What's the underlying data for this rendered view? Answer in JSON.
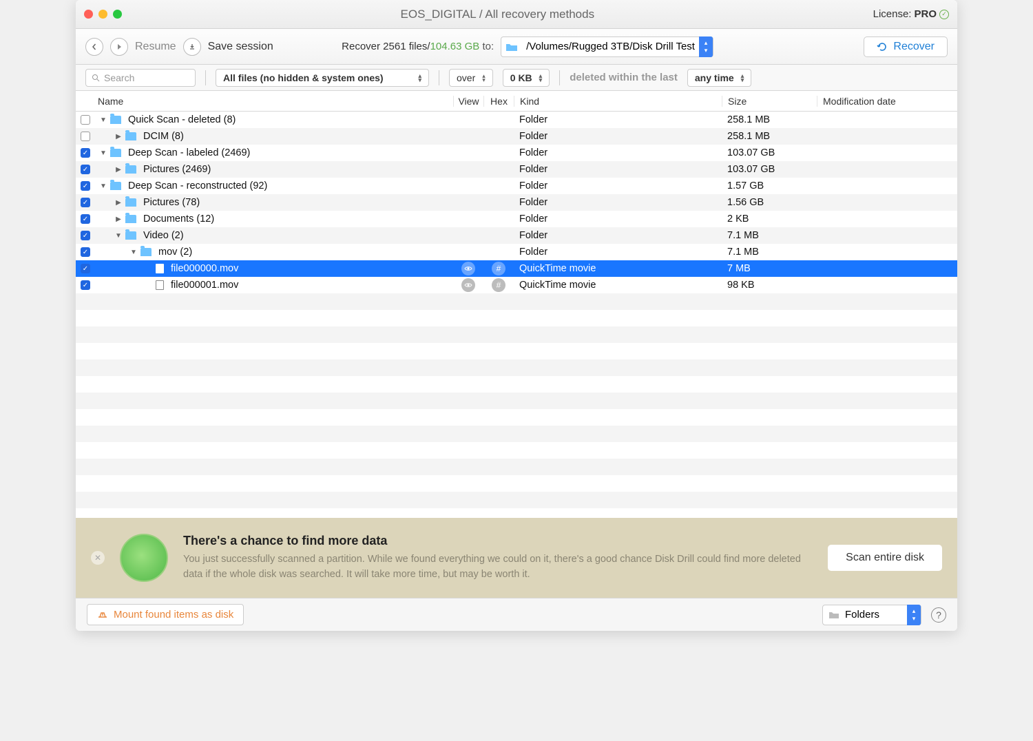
{
  "titlebar": {
    "title": "EOS_DIGITAL / All recovery methods",
    "license_label": "License:",
    "license_tier": "PRO"
  },
  "toolbar": {
    "resume": "Resume",
    "save_session": "Save session",
    "recover_prefix": "Recover ",
    "recover_count": "2561 files/",
    "recover_size": "104.63 GB",
    "to": " to:",
    "destination": "/Volumes/Rugged 3TB/Disk Drill Test",
    "recover_button": "Recover"
  },
  "filters": {
    "search_placeholder": "Search",
    "file_filter": "All files (no hidden & system ones)",
    "size_op": "over",
    "size_val": "0 KB",
    "deleted_label": "deleted within the last",
    "time": "any time"
  },
  "columns": {
    "name": "Name",
    "view": "View",
    "hex": "Hex",
    "kind": "Kind",
    "size": "Size",
    "mod": "Modification date"
  },
  "rows": [
    {
      "checked": false,
      "indent": 0,
      "expanded": true,
      "icon": "folder",
      "name": "Quick Scan - deleted (8)",
      "kind": "Folder",
      "size": "258.1 MB",
      "selected": false,
      "isfile": false
    },
    {
      "checked": false,
      "indent": 1,
      "expanded": false,
      "icon": "folder",
      "name": "DCIM (8)",
      "kind": "Folder",
      "size": "258.1 MB",
      "selected": false,
      "isfile": false
    },
    {
      "checked": true,
      "indent": 0,
      "expanded": true,
      "icon": "folder",
      "name": "Deep Scan - labeled (2469)",
      "kind": "Folder",
      "size": "103.07 GB",
      "selected": false,
      "isfile": false
    },
    {
      "checked": true,
      "indent": 1,
      "expanded": false,
      "icon": "folder",
      "name": "Pictures (2469)",
      "kind": "Folder",
      "size": "103.07 GB",
      "selected": false,
      "isfile": false
    },
    {
      "checked": true,
      "indent": 0,
      "expanded": true,
      "icon": "folder",
      "name": "Deep Scan - reconstructed (92)",
      "kind": "Folder",
      "size": "1.57 GB",
      "selected": false,
      "isfile": false
    },
    {
      "checked": true,
      "indent": 1,
      "expanded": false,
      "icon": "folder",
      "name": "Pictures (78)",
      "kind": "Folder",
      "size": "1.56 GB",
      "selected": false,
      "isfile": false
    },
    {
      "checked": true,
      "indent": 1,
      "expanded": false,
      "icon": "folder",
      "name": "Documents (12)",
      "kind": "Folder",
      "size": "2 KB",
      "selected": false,
      "isfile": false
    },
    {
      "checked": true,
      "indent": 1,
      "expanded": true,
      "icon": "folder",
      "name": "Video (2)",
      "kind": "Folder",
      "size": "7.1 MB",
      "selected": false,
      "isfile": false
    },
    {
      "checked": true,
      "indent": 2,
      "expanded": true,
      "icon": "folder",
      "name": "mov (2)",
      "kind": "Folder",
      "size": "7.1 MB",
      "selected": false,
      "isfile": false
    },
    {
      "checked": true,
      "indent": 3,
      "icon": "file",
      "name": "file000000.mov",
      "kind": "QuickTime movie",
      "size": "7 MB",
      "selected": true,
      "isfile": true
    },
    {
      "checked": true,
      "indent": 3,
      "icon": "file",
      "name": "file000001.mov",
      "kind": "QuickTime movie",
      "size": "98 KB",
      "selected": false,
      "isfile": true
    }
  ],
  "banner": {
    "heading": "There's a chance to find more data",
    "body": "You just successfully scanned a partition. While we found everything we could on it, there's a good chance Disk Drill could find more deleted data if the whole disk was searched. It will take more time, but may be worth it.",
    "button": "Scan entire disk"
  },
  "bottom": {
    "mount": "Mount found items as disk",
    "view": "Folders"
  }
}
